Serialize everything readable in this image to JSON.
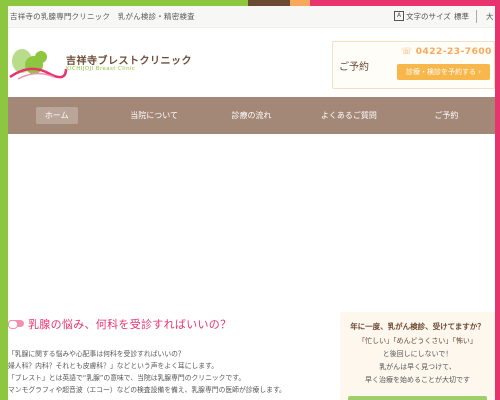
{
  "topbar": {
    "tagline": "吉祥寺の乳腺専門クリニック　乳がん検診・精密検査",
    "font_size_label": "文字のサイズ",
    "font_standard": "標準",
    "font_large": "大",
    "font_icon_glyph": "A"
  },
  "header": {
    "brand_name": "吉祥寺ブレストクリニック",
    "brand_en": "KICHIJOJI Breast Clinic",
    "reservation_label": "ご予約",
    "phone": "0422-23-7600",
    "reservation_button": "診療・検診を予約する",
    "arrow": "›"
  },
  "nav": {
    "items": [
      "ホーム",
      "当院について",
      "診療の流れ",
      "よくあるご質問",
      "ご予約"
    ]
  },
  "main": {
    "heading": "乳腺の悩み、何科を受診すればいいの？",
    "paragraphs": [
      "「乳腺に関する悩みや心配事は何科を受診すればいいの？",
      "婦人科？内科？それとも皮膚科？」などという声をよく耳にします。",
      "「ブレスト」とは英語で“乳腺”の意味で、当院は乳腺専門のクリニックです。",
      "マンモグラフィや超音波（エコー）などの検査設備を備え、乳腺専門の医師が診療します。"
    ]
  },
  "side": {
    "title": "年に一度、乳がん検診、受けてますか？",
    "line1": "「忙しい」「めんどうくさい」「怖い」",
    "line2": "と後回しにしないで！",
    "line3": "乳がんは早く見つけて、",
    "line4": "早く治療を始めることが大切です"
  },
  "colors": {
    "green": "#8dc63f",
    "pink": "#e8336e",
    "brown": "#6b4a34",
    "nav": "#a38777",
    "orange": "#f7b74b"
  },
  "icons": [
    "logo-squirrel-icon",
    "phone-icon",
    "font-size-icon",
    "pill-icon"
  ]
}
